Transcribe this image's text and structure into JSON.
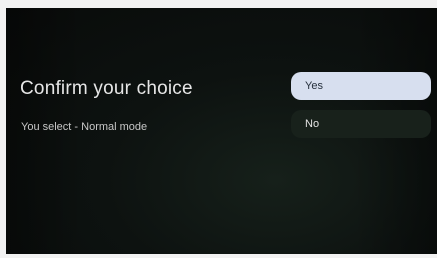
{
  "dialog": {
    "title": "Confirm your choice",
    "subtitle": "You select - Normal mode",
    "options": [
      {
        "label": "Yes",
        "focused": true
      },
      {
        "label": "No",
        "focused": false
      }
    ]
  },
  "colors": {
    "background": "#0d1210",
    "focused_option_bg": "#d7dfef",
    "focused_option_text": "#26303d",
    "option_bg": "#18211b",
    "option_text": "#e4e4e4",
    "title_text": "#e6e6e6"
  }
}
